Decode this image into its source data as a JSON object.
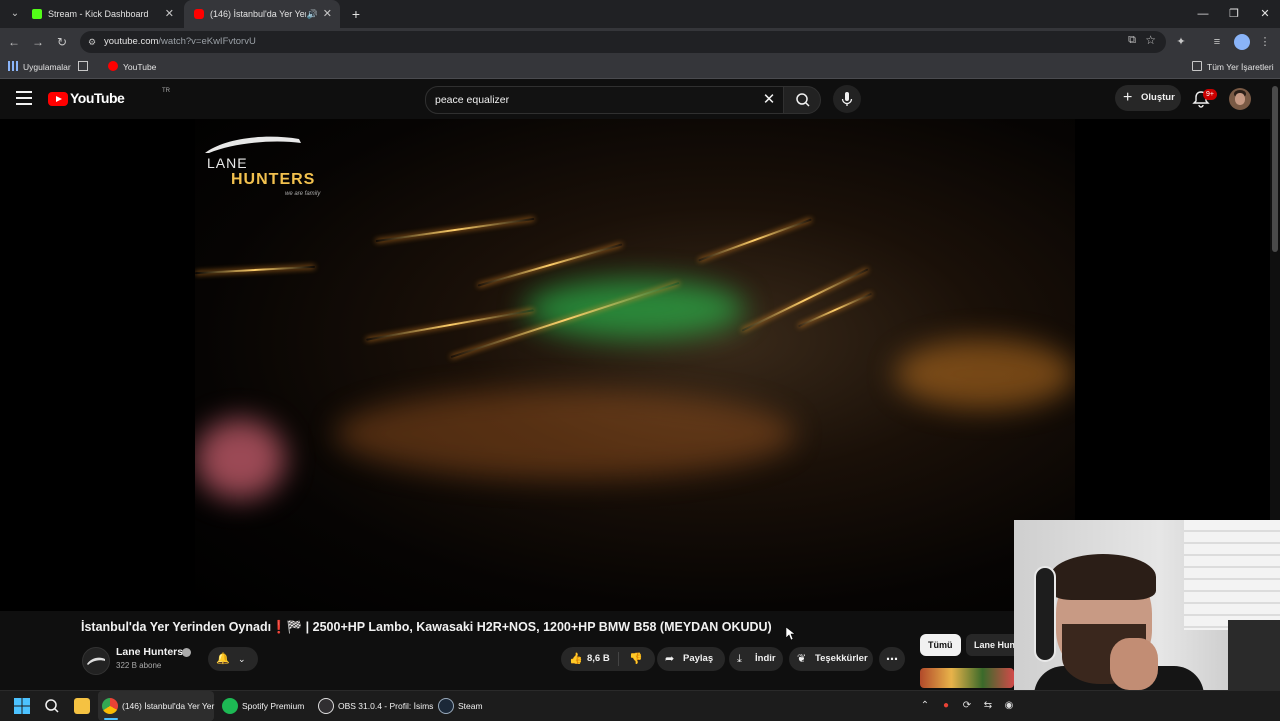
{
  "browser": {
    "tabs": [
      {
        "title": "Stream - Kick Dashboard",
        "favicon_color": "#53fc18"
      },
      {
        "title": "(146) İstanbul'da Yer Yerinde...",
        "favicon_color": "#ff0000"
      }
    ],
    "url_host": "youtube.com",
    "url_path": "/watch?v=eKwIFvtorvU",
    "bookmarks": [
      {
        "label": "Uygulamalar"
      },
      {
        "label": "YouTube"
      }
    ],
    "all_bookmarks_label": "Tüm Yer İşaretleri"
  },
  "youtube": {
    "logo_text": "YouTube",
    "country_code": "TR",
    "search_query": "peace equalizer",
    "create_label": "Oluştur",
    "notification_badge": "9+",
    "brand_red": "#ff0000"
  },
  "video": {
    "watermark_line1": "LANE",
    "watermark_line2": "HUNTERS",
    "watermark_tagline": "we are family",
    "title": "İstanbul'da Yer Yerinden Oynadı❗🏁 | 2500+HP Lambo, Kawasaki H2R+NOS, 1200+HP BMW B58 (MEYDAN OKUDU)",
    "channel_name": "Lane Hunters",
    "subscribers": "322 B abone",
    "likes": "8,6 B",
    "share_label": "Paylaş",
    "download_label": "İndir",
    "thanks_label": "Teşekkürler"
  },
  "sidebar_chips": [
    {
      "label": "Tümü",
      "active": true
    },
    {
      "label": "Lane Hun",
      "active": false
    }
  ],
  "taskbar": {
    "items": [
      {
        "label": "(146) İstanbul'da Yer Yer",
        "icon": "chrome-icon",
        "color": "#e94235"
      },
      {
        "label": "Spotify Premium",
        "icon": "spotify-icon",
        "color": "#1db954"
      },
      {
        "label": "OBS 31.0.4 - Profil: İsims",
        "icon": "obs-icon",
        "color": "#302e31"
      },
      {
        "label": "Steam",
        "icon": "steam-icon",
        "color": "#1b2838"
      }
    ]
  }
}
